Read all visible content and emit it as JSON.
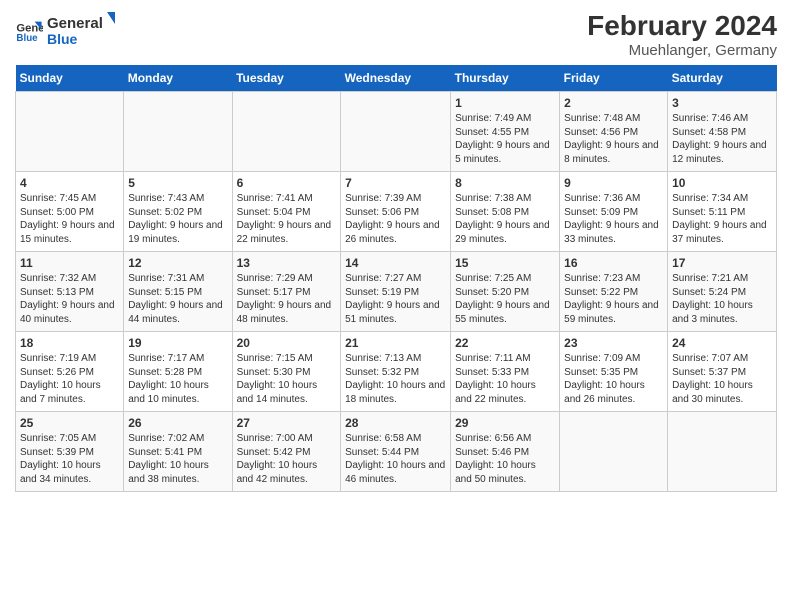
{
  "header": {
    "logo_line1": "General",
    "logo_line2": "Blue",
    "title": "February 2024",
    "subtitle": "Muehlanger, Germany"
  },
  "columns": [
    "Sunday",
    "Monday",
    "Tuesday",
    "Wednesday",
    "Thursday",
    "Friday",
    "Saturday"
  ],
  "weeks": [
    [
      {
        "day": "",
        "info": ""
      },
      {
        "day": "",
        "info": ""
      },
      {
        "day": "",
        "info": ""
      },
      {
        "day": "",
        "info": ""
      },
      {
        "day": "1",
        "info": "Sunrise: 7:49 AM\nSunset: 4:55 PM\nDaylight: 9 hours and 5 minutes."
      },
      {
        "day": "2",
        "info": "Sunrise: 7:48 AM\nSunset: 4:56 PM\nDaylight: 9 hours and 8 minutes."
      },
      {
        "day": "3",
        "info": "Sunrise: 7:46 AM\nSunset: 4:58 PM\nDaylight: 9 hours and 12 minutes."
      }
    ],
    [
      {
        "day": "4",
        "info": "Sunrise: 7:45 AM\nSunset: 5:00 PM\nDaylight: 9 hours and 15 minutes."
      },
      {
        "day": "5",
        "info": "Sunrise: 7:43 AM\nSunset: 5:02 PM\nDaylight: 9 hours and 19 minutes."
      },
      {
        "day": "6",
        "info": "Sunrise: 7:41 AM\nSunset: 5:04 PM\nDaylight: 9 hours and 22 minutes."
      },
      {
        "day": "7",
        "info": "Sunrise: 7:39 AM\nSunset: 5:06 PM\nDaylight: 9 hours and 26 minutes."
      },
      {
        "day": "8",
        "info": "Sunrise: 7:38 AM\nSunset: 5:08 PM\nDaylight: 9 hours and 29 minutes."
      },
      {
        "day": "9",
        "info": "Sunrise: 7:36 AM\nSunset: 5:09 PM\nDaylight: 9 hours and 33 minutes."
      },
      {
        "day": "10",
        "info": "Sunrise: 7:34 AM\nSunset: 5:11 PM\nDaylight: 9 hours and 37 minutes."
      }
    ],
    [
      {
        "day": "11",
        "info": "Sunrise: 7:32 AM\nSunset: 5:13 PM\nDaylight: 9 hours and 40 minutes."
      },
      {
        "day": "12",
        "info": "Sunrise: 7:31 AM\nSunset: 5:15 PM\nDaylight: 9 hours and 44 minutes."
      },
      {
        "day": "13",
        "info": "Sunrise: 7:29 AM\nSunset: 5:17 PM\nDaylight: 9 hours and 48 minutes."
      },
      {
        "day": "14",
        "info": "Sunrise: 7:27 AM\nSunset: 5:19 PM\nDaylight: 9 hours and 51 minutes."
      },
      {
        "day": "15",
        "info": "Sunrise: 7:25 AM\nSunset: 5:20 PM\nDaylight: 9 hours and 55 minutes."
      },
      {
        "day": "16",
        "info": "Sunrise: 7:23 AM\nSunset: 5:22 PM\nDaylight: 9 hours and 59 minutes."
      },
      {
        "day": "17",
        "info": "Sunrise: 7:21 AM\nSunset: 5:24 PM\nDaylight: 10 hours and 3 minutes."
      }
    ],
    [
      {
        "day": "18",
        "info": "Sunrise: 7:19 AM\nSunset: 5:26 PM\nDaylight: 10 hours and 7 minutes."
      },
      {
        "day": "19",
        "info": "Sunrise: 7:17 AM\nSunset: 5:28 PM\nDaylight: 10 hours and 10 minutes."
      },
      {
        "day": "20",
        "info": "Sunrise: 7:15 AM\nSunset: 5:30 PM\nDaylight: 10 hours and 14 minutes."
      },
      {
        "day": "21",
        "info": "Sunrise: 7:13 AM\nSunset: 5:32 PM\nDaylight: 10 hours and 18 minutes."
      },
      {
        "day": "22",
        "info": "Sunrise: 7:11 AM\nSunset: 5:33 PM\nDaylight: 10 hours and 22 minutes."
      },
      {
        "day": "23",
        "info": "Sunrise: 7:09 AM\nSunset: 5:35 PM\nDaylight: 10 hours and 26 minutes."
      },
      {
        "day": "24",
        "info": "Sunrise: 7:07 AM\nSunset: 5:37 PM\nDaylight: 10 hours and 30 minutes."
      }
    ],
    [
      {
        "day": "25",
        "info": "Sunrise: 7:05 AM\nSunset: 5:39 PM\nDaylight: 10 hours and 34 minutes."
      },
      {
        "day": "26",
        "info": "Sunrise: 7:02 AM\nSunset: 5:41 PM\nDaylight: 10 hours and 38 minutes."
      },
      {
        "day": "27",
        "info": "Sunrise: 7:00 AM\nSunset: 5:42 PM\nDaylight: 10 hours and 42 minutes."
      },
      {
        "day": "28",
        "info": "Sunrise: 6:58 AM\nSunset: 5:44 PM\nDaylight: 10 hours and 46 minutes."
      },
      {
        "day": "29",
        "info": "Sunrise: 6:56 AM\nSunset: 5:46 PM\nDaylight: 10 hours and 50 minutes."
      },
      {
        "day": "",
        "info": ""
      },
      {
        "day": "",
        "info": ""
      }
    ]
  ]
}
